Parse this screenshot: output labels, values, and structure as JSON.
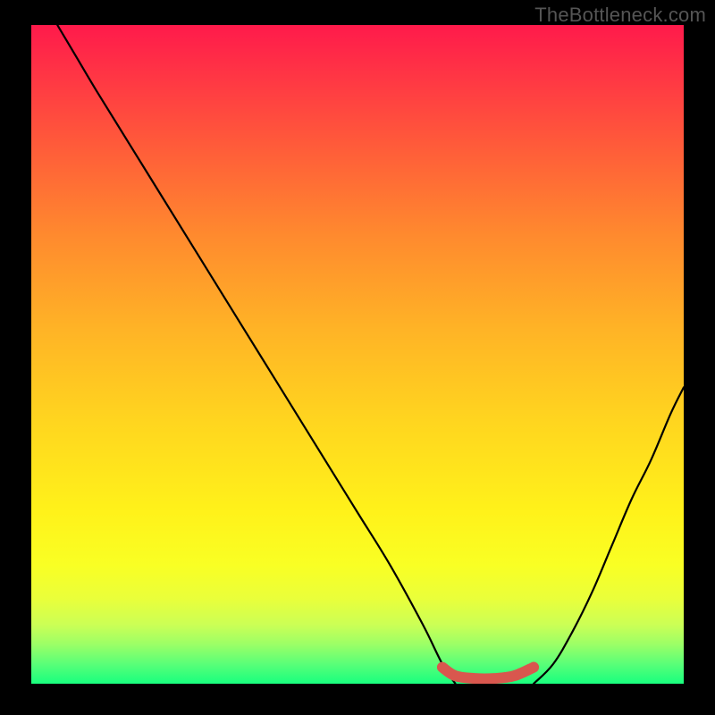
{
  "watermark": "TheBottleneck.com",
  "chart_data": {
    "type": "line",
    "title": "",
    "xlabel": "",
    "ylabel": "",
    "xlim": [
      0,
      100
    ],
    "ylim": [
      0,
      100
    ],
    "grid": false,
    "series": [
      {
        "name": "bottleneck-curve-left",
        "x": [
          4,
          7,
          10,
          15,
          20,
          25,
          30,
          35,
          40,
          45,
          50,
          55,
          60,
          63,
          65
        ],
        "y": [
          100,
          95,
          90,
          82,
          74,
          66,
          58,
          50,
          42,
          34,
          26,
          18,
          9,
          3,
          0
        ]
      },
      {
        "name": "bottleneck-curve-right",
        "x": [
          77,
          80,
          83,
          86,
          89,
          92,
          95,
          98,
          100
        ],
        "y": [
          0,
          3,
          8,
          14,
          21,
          28,
          34,
          41,
          45
        ]
      },
      {
        "name": "optimal-range",
        "x": [
          63,
          65,
          68,
          71,
          74,
          77
        ],
        "y": [
          2.5,
          1.2,
          0.8,
          0.8,
          1.2,
          2.5
        ]
      }
    ],
    "colors": {
      "curve": "#000000",
      "optimal": "#d9574e",
      "gradient_top": "#ff1a4b",
      "gradient_bottom": "#18ff7e"
    }
  }
}
